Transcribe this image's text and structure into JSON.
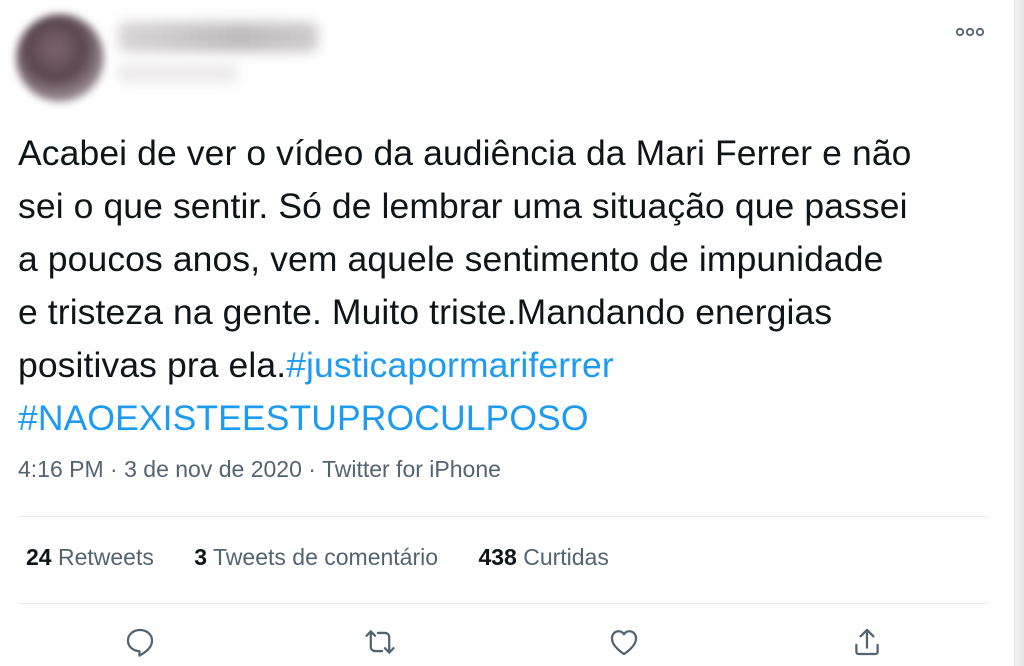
{
  "tweet": {
    "text_lines": [
      "Acabei de ver o vídeo da audiência da Mari Ferrer e não",
      "sei o que sentir. Só de lembrar uma situação que passei",
      "a poucos anos, vem aquele sentimento de impunidade",
      "e tristeza na gente. Muito triste.Mandando energias",
      "positivas pra ela."
    ],
    "hashtag1": "#justicapormariferrer",
    "hashtag2": "#NAOEXISTEESTUPROCULPOSO",
    "time": "4:16 PM",
    "date": "3 de nov de 2020",
    "source": "Twitter for iPhone",
    "separator": "·"
  },
  "stats": {
    "retweets_count": "24",
    "retweets_label": "Retweets",
    "quotes_count": "3",
    "quotes_label": "Tweets de comentário",
    "likes_count": "438",
    "likes_label": "Curtidas"
  },
  "icons": {
    "more": "more-dots-icon",
    "reply": "reply-icon",
    "retweet": "retweet-icon",
    "like": "heart-icon",
    "share": "share-icon"
  },
  "colors": {
    "text": "#0f1419",
    "secondary": "#536471",
    "hashtag": "#1d9bf0",
    "divider": "#e6ecf0"
  }
}
